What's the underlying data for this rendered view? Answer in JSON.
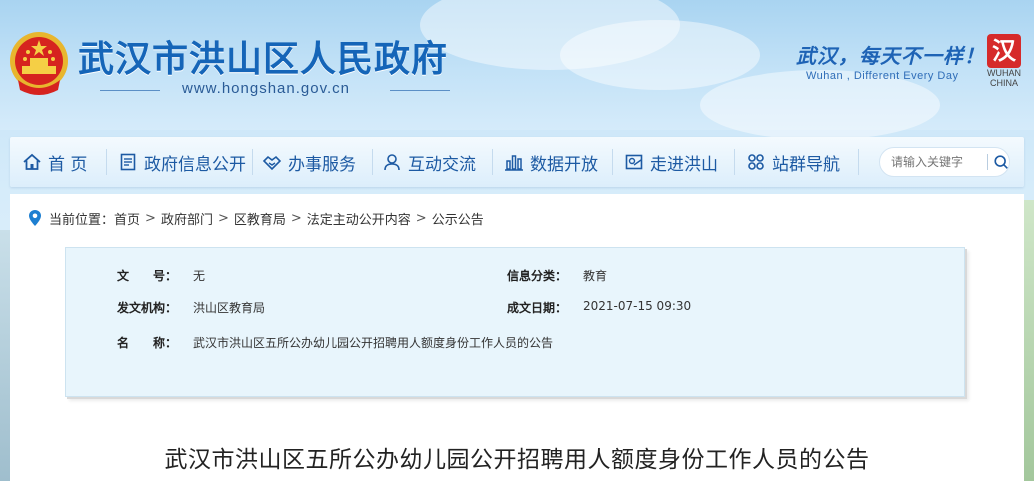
{
  "header": {
    "site_title": "武汉市洪山区人民政府",
    "site_url": "www.hongshan.gov.cn",
    "slogan": "武汉，每天不一样！",
    "slogan_en": "Wuhan , Different Every Day",
    "logo_text_1": "WUHAN",
    "logo_text_2": "CHINA",
    "logo_mark": "汉"
  },
  "nav": {
    "items": [
      {
        "label": "首 页",
        "icon": "home-icon"
      },
      {
        "label": "政府信息公开",
        "icon": "document-icon"
      },
      {
        "label": "办事服务",
        "icon": "handshake-icon"
      },
      {
        "label": "互动交流",
        "icon": "chat-icon"
      },
      {
        "label": "数据开放",
        "icon": "bar-chart-icon"
      },
      {
        "label": "走进洪山",
        "icon": "map-icon"
      },
      {
        "label": "站群导航",
        "icon": "grid-icon"
      }
    ],
    "search_placeholder": "请输入关键字"
  },
  "breadcrumb": {
    "prefix": "当前位置：",
    "items": [
      "首页",
      "政府部门",
      "区教育局",
      "法定主动公开内容",
      "公示公告"
    ]
  },
  "info": {
    "doc_no_label": "文　　号：",
    "doc_no_value": "无",
    "category_label": "信息分类：",
    "category_value": "教育",
    "issuer_label": "发文机构：",
    "issuer_value": "洪山区教育局",
    "date_label": "成文日期：",
    "date_value": "2021-07-15 09:30",
    "name_label": "名　　称：",
    "name_value": "武汉市洪山区五所公办幼儿园公开招聘用人额度身份工作人员的公告"
  },
  "article": {
    "title": "武汉市洪山区五所公办幼儿园公开招聘用人额度身份工作人员的公告"
  },
  "colors": {
    "primary": "#1565b8",
    "nav_text": "#1d5aa3",
    "info_bg": "#e8f5fc"
  }
}
